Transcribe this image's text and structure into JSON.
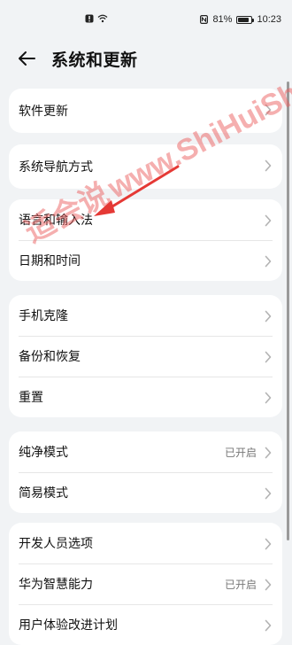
{
  "status_bar": {
    "battery_percent": "81%",
    "time": "10:23",
    "battery_level": 0.81
  },
  "header": {
    "title": "系统和更新"
  },
  "groups": [
    {
      "rows": [
        {
          "label": "软件更新",
          "value": ""
        }
      ]
    },
    {
      "rows": [
        {
          "label": "系统导航方式",
          "value": ""
        }
      ]
    },
    {
      "rows": [
        {
          "label": "语言和输入法",
          "value": ""
        },
        {
          "label": "日期和时间",
          "value": ""
        }
      ]
    },
    {
      "rows": [
        {
          "label": "手机克隆",
          "value": ""
        },
        {
          "label": "备份和恢复",
          "value": ""
        },
        {
          "label": "重置",
          "value": ""
        }
      ]
    },
    {
      "rows": [
        {
          "label": "纯净模式",
          "value": "已开启"
        },
        {
          "label": "简易模式",
          "value": ""
        }
      ]
    },
    {
      "rows": [
        {
          "label": "开发人员选项",
          "value": ""
        },
        {
          "label": "华为智慧能力",
          "value": "已开启"
        },
        {
          "label": "用户体验改进计划",
          "value": ""
        }
      ]
    }
  ],
  "watermark": {
    "cn": "适会说",
    "en": "www.ShiHuiShuo.Com"
  },
  "colors": {
    "annotation_arrow": "#e53935",
    "background": "#f1f3f5"
  }
}
